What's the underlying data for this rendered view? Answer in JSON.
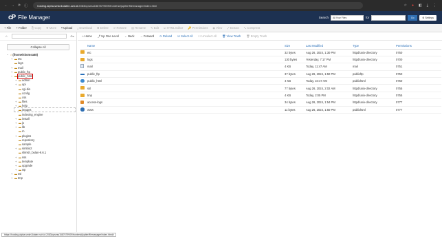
{
  "browser": {
    "nav": [
      "←",
      "→",
      "⟳",
      "ⓘ"
    ],
    "url_host": "hosting.alpha.smkn1klaten.sch.id",
    "url_rest": ":2083/cpsess1587679909/frontend/jupiter/filemanager/index.html",
    "ext_icons": [
      "☆",
      "●",
      "◧",
      "⤓",
      "⋮"
    ]
  },
  "header": {
    "brand": "File Manager",
    "search_label": "Search",
    "search_scope": "All Your Files",
    "for_label": "for",
    "go_label": "Go",
    "settings_label": "⚙ Settings"
  },
  "toolbar": {
    "items": [
      {
        "label": "+ File",
        "enabled": true
      },
      {
        "label": "+ Folder",
        "enabled": true
      },
      {
        "label": "⎘ Copy",
        "enabled": false
      },
      {
        "label": "✥ Move",
        "enabled": false
      },
      {
        "label": "⤒ Upload",
        "enabled": true
      },
      {
        "label": "⤓ Download",
        "enabled": false
      },
      {
        "label": "✖ Delete",
        "enabled": false
      },
      {
        "label": "↺ Restore",
        "enabled": false
      },
      {
        "label": "▤ Rename",
        "enabled": false
      },
      {
        "label": "✎ Edit",
        "enabled": false
      },
      {
        "label": "☑ HTML Editor",
        "enabled": false
      },
      {
        "label": "🔑 Permissions",
        "enabled": false
      },
      {
        "label": "◉ View",
        "enabled": false
      },
      {
        "label": "⤢ Extract",
        "enabled": false
      },
      {
        "label": "⤡ Compress",
        "enabled": false
      }
    ]
  },
  "sidebar": {
    "home_icon": "⌂",
    "go_label": "Go",
    "collapse_label": "Collapse All",
    "tree": [
      {
        "label": "(/home/skomsa58)",
        "depth": 0,
        "pm": "−",
        "home": true
      },
      {
        "label": "etc",
        "depth": 1,
        "pm": "+"
      },
      {
        "label": "logs",
        "depth": 1,
        "pm": ""
      },
      {
        "label": "mail",
        "depth": 1,
        "pm": "+"
      },
      {
        "label": "public_ftp",
        "depth": 1,
        "pm": "+"
      },
      {
        "label": "public_html",
        "depth": 1,
        "pm": "−",
        "selected": true
      },
      {
        "label": "admin",
        "depth": 2,
        "pm": "+"
      },
      {
        "label": "api",
        "depth": 2,
        "pm": "+"
      },
      {
        "label": "cgi-bin",
        "depth": 2,
        "pm": ""
      },
      {
        "label": "config",
        "depth": 2,
        "pm": ""
      },
      {
        "label": "css",
        "depth": 2,
        "pm": ""
      },
      {
        "label": "files",
        "depth": 2,
        "pm": "+"
      },
      {
        "label": "help",
        "depth": 2,
        "pm": "+"
      },
      {
        "label": "images",
        "depth": 2,
        "pm": ""
      },
      {
        "label": "indexing_engine",
        "depth": 2,
        "pm": ""
      },
      {
        "label": "install",
        "depth": 2,
        "pm": "+"
      },
      {
        "label": "js",
        "depth": 2,
        "pm": "+"
      },
      {
        "label": "lib",
        "depth": 2,
        "pm": "+"
      },
      {
        "label": "m",
        "depth": 2,
        "pm": ""
      },
      {
        "label": "plugins",
        "depth": 2,
        "pm": "+"
      },
      {
        "label": "repository",
        "depth": 2,
        "pm": ""
      },
      {
        "label": "sample",
        "depth": 2,
        "pm": ""
      },
      {
        "label": "simbio2",
        "depth": 2,
        "pm": "+"
      },
      {
        "label": "slimsh_bulan-9.6.1",
        "depth": 2,
        "pm": ""
      },
      {
        "label": "sss",
        "depth": 2,
        "pm": "+"
      },
      {
        "label": "template",
        "depth": 2,
        "pm": "+"
      },
      {
        "label": "upgrade",
        "depth": 2,
        "pm": "+"
      },
      {
        "label": "wp",
        "depth": 2,
        "pm": "+"
      },
      {
        "label": "ssl",
        "depth": 1,
        "pm": "+"
      },
      {
        "label": "tmp",
        "depth": 1,
        "pm": "+"
      }
    ]
  },
  "actionbar": {
    "items": [
      {
        "label": "⌂ Home",
        "style": "normal"
      },
      {
        "label": "⤴ Up One Level",
        "style": "normal"
      },
      {
        "label": "← Back",
        "style": "normal"
      },
      {
        "label": "→ Forward",
        "style": "normal"
      },
      {
        "label": "⟳ Reload",
        "style": "blue"
      },
      {
        "label": "☑ Select All",
        "style": "blue"
      },
      {
        "label": "☐ Unselect All",
        "style": "dis"
      },
      {
        "label": "🗑 View Trash",
        "style": "blue"
      },
      {
        "label": "🗑 Empty Trash",
        "style": "dis"
      }
    ]
  },
  "table": {
    "headers": [
      "Name",
      "Size",
      "Last Modified",
      "Type",
      "Permissions"
    ],
    "rows": [
      {
        "icon": "folder",
        "name": "etc",
        "size": "32 bytes",
        "modified": "Aug 26, 2024, 1:30 PM",
        "type": "httpd/unix-directory",
        "perm": "0750"
      },
      {
        "icon": "folder",
        "name": "logs",
        "size": "130 bytes",
        "modified": "Yesterday, 7:17 PM",
        "type": "httpd/unix-directory",
        "perm": "0700"
      },
      {
        "icon": "doc",
        "name": "mail",
        "size": "4 KB",
        "modified": "Today, 11:47 AM",
        "type": "mail",
        "perm": "0751"
      },
      {
        "icon": "link",
        "name": "public_ftp",
        "size": "37 bytes",
        "modified": "Aug 26, 2024, 1:50 PM",
        "type": "publicftp",
        "perm": "0750"
      },
      {
        "icon": "globe",
        "name": "public_html",
        "size": "4 KB",
        "modified": "Today, 10:47 AM",
        "type": "publichtml",
        "perm": "0750"
      },
      {
        "icon": "folder",
        "name": "ssl",
        "size": "77 bytes",
        "modified": "Aug 26, 2024, 2:02 AM",
        "type": "httpd/unix-directory",
        "perm": "0755"
      },
      {
        "icon": "folder",
        "name": "tmp",
        "size": "4 KB",
        "modified": "Today, 2:05 PM",
        "type": "httpd/unix-directory",
        "perm": "0755"
      },
      {
        "icon": "tool",
        "name": "access-logs",
        "size": "34 bytes",
        "modified": "Aug 26, 2024, 1:54 PM",
        "type": "httpd/unix-directory",
        "perm": "0777"
      },
      {
        "icon": "globe2",
        "name": "www",
        "size": "11 bytes",
        "modified": "Aug 26, 2024, 1:50 PM",
        "type": "publichtml",
        "perm": "0777"
      }
    ]
  },
  "status_url": "https://hosting.alpha.smkn1klaten.sch.id:2083/cpsess1587679909/frontend/jupiter/filemanager/index.html#"
}
